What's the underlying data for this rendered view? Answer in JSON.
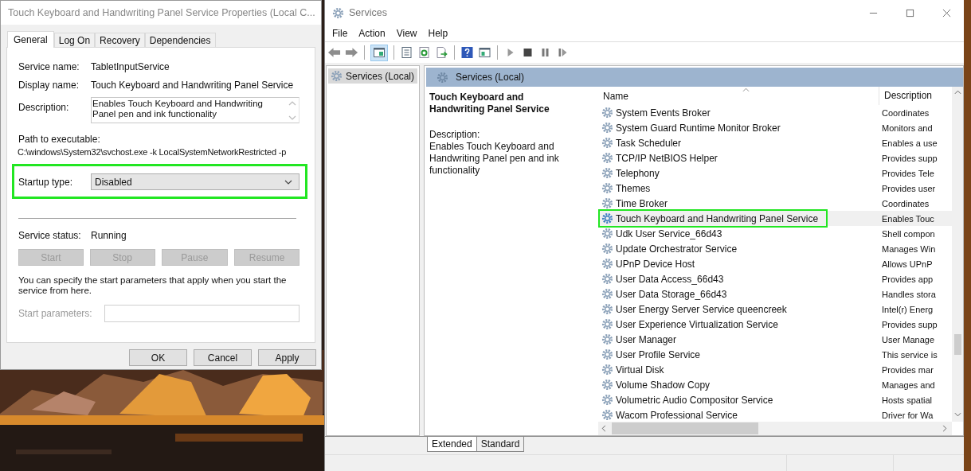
{
  "properties_dialog": {
    "title": "Touch Keyboard and Handwriting Panel Service Properties (Local C...",
    "tabs": [
      {
        "label": "General",
        "selected": true
      },
      {
        "label": "Log On",
        "selected": false
      },
      {
        "label": "Recovery",
        "selected": false
      },
      {
        "label": "Dependencies",
        "selected": false
      }
    ],
    "fields": [
      {
        "label": "Service name:",
        "value": "TabletInputService"
      },
      {
        "label": "Display name:",
        "value": "Touch Keyboard and Handwriting Panel Service"
      }
    ],
    "description": {
      "label": "Description:",
      "value": "Enables Touch Keyboard and Handwriting Panel pen and ink functionality"
    },
    "path": {
      "label": "Path to executable:",
      "value": "C:\\windows\\System32\\svchost.exe -k LocalSystemNetworkRestricted -p"
    },
    "startup_type": {
      "label": "Startup type:",
      "value": "Disabled",
      "highlighted": true
    },
    "service_status": {
      "label": "Service status:",
      "value": "Running"
    },
    "control_buttons": [
      {
        "label": "Start",
        "disabled": true
      },
      {
        "label": "Stop",
        "disabled": true
      },
      {
        "label": "Pause",
        "disabled": true
      },
      {
        "label": "Resume",
        "disabled": true
      }
    ],
    "hint": "You can specify the start parameters that apply when you start the service from here.",
    "start_parameters": {
      "label": "Start parameters:",
      "disabled": true
    },
    "buttons": [
      "OK",
      "Cancel",
      "Apply"
    ]
  },
  "services_window": {
    "title": "Services",
    "menu": [
      "File",
      "Action",
      "View",
      "Help"
    ],
    "tree": [
      {
        "label": "Services (Local)",
        "selected": true
      }
    ],
    "pane_title": "Services (Local)",
    "detail": {
      "title": "Touch Keyboard and Handwriting Panel Service",
      "description_label": "Description:",
      "description": "Enables Touch Keyboard and Handwriting Panel pen and ink functionality"
    },
    "columns": [
      "Name",
      "Description"
    ],
    "rows": [
      {
        "name": "System Events Broker",
        "description": "Coordinates",
        "selected": false,
        "highlighted": false
      },
      {
        "name": "System Guard Runtime Monitor Broker",
        "description": "Monitors and",
        "selected": false,
        "highlighted": false
      },
      {
        "name": "Task Scheduler",
        "description": "Enables a use",
        "selected": false,
        "highlighted": false
      },
      {
        "name": "TCP/IP NetBIOS Helper",
        "description": "Provides supp",
        "selected": false,
        "highlighted": false
      },
      {
        "name": "Telephony",
        "description": "Provides Tele",
        "selected": false,
        "highlighted": false
      },
      {
        "name": "Themes",
        "description": "Provides user",
        "selected": false,
        "highlighted": false
      },
      {
        "name": "Time Broker",
        "description": "Coordinates",
        "selected": false,
        "highlighted": false
      },
      {
        "name": "Touch Keyboard and Handwriting Panel Service",
        "description": "Enables Touc",
        "selected": true,
        "highlighted": true
      },
      {
        "name": "Udk User Service_66d43",
        "description": "Shell compon",
        "selected": false,
        "highlighted": false
      },
      {
        "name": "Update Orchestrator Service",
        "description": "Manages Win",
        "selected": false,
        "highlighted": false
      },
      {
        "name": "UPnP Device Host",
        "description": "Allows UPnP",
        "selected": false,
        "highlighted": false
      },
      {
        "name": "User Data Access_66d43",
        "description": "Provides app",
        "selected": false,
        "highlighted": false
      },
      {
        "name": "User Data Storage_66d43",
        "description": "Handles stora",
        "selected": false,
        "highlighted": false
      },
      {
        "name": "User Energy Server Service queencreek",
        "description": "Intel(r) Energ",
        "selected": false,
        "highlighted": false
      },
      {
        "name": "User Experience Virtualization Service",
        "description": "Provides supp",
        "selected": false,
        "highlighted": false
      },
      {
        "name": "User Manager",
        "description": "User Manage",
        "selected": false,
        "highlighted": false
      },
      {
        "name": "User Profile Service",
        "description": "This service is",
        "selected": false,
        "highlighted": false
      },
      {
        "name": "Virtual Disk",
        "description": "Provides mar",
        "selected": false,
        "highlighted": false
      },
      {
        "name": "Volume Shadow Copy",
        "description": "Manages and",
        "selected": false,
        "highlighted": false
      },
      {
        "name": "Volumetric Audio Compositor Service",
        "description": "Hosts spatial",
        "selected": false,
        "highlighted": false
      },
      {
        "name": "Wacom Professional Service",
        "description": "Driver for Wa",
        "selected": false,
        "highlighted": false
      }
    ],
    "view_tabs": [
      {
        "label": "Extended",
        "selected": true
      },
      {
        "label": "Standard",
        "selected": false
      }
    ]
  }
}
